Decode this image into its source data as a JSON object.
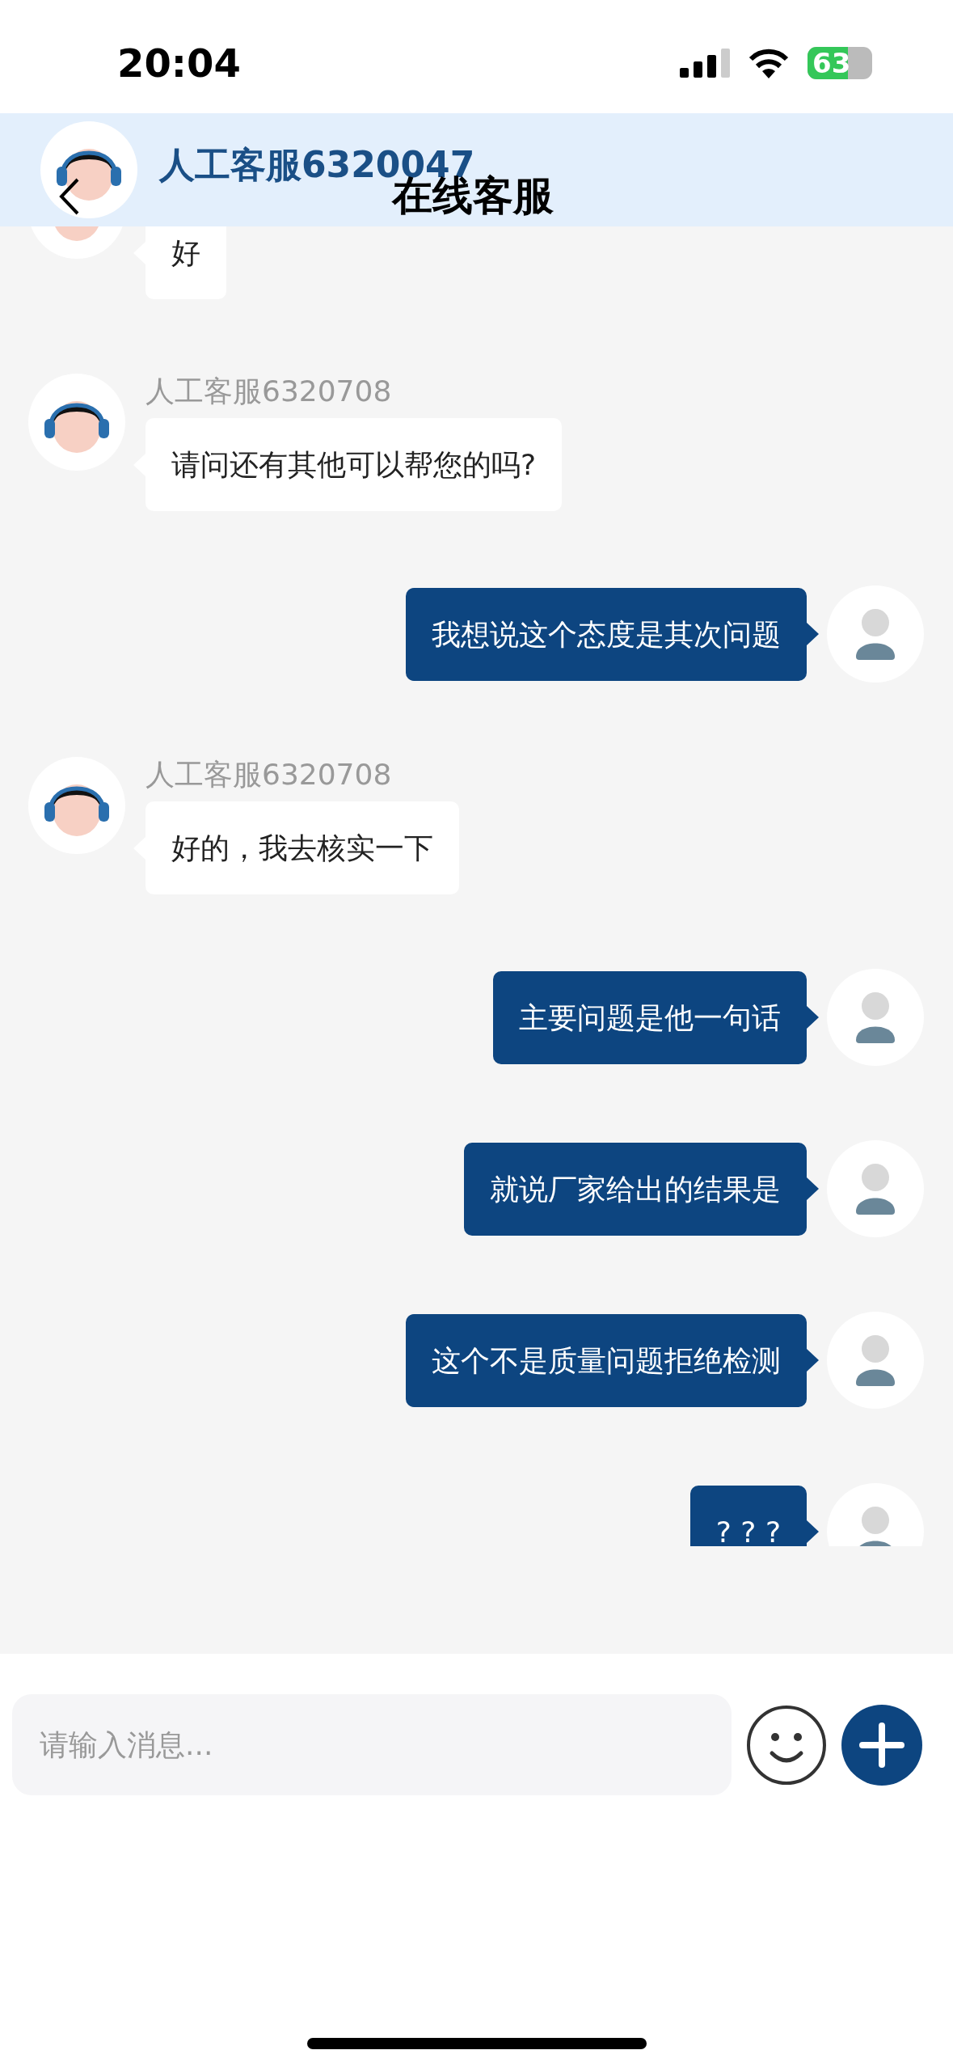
{
  "status_bar": {
    "time": "20:04",
    "battery": "63"
  },
  "header": {
    "agent_name": "人工客服6320047",
    "title": "在线客服"
  },
  "messages": [
    {
      "kind": "agent",
      "text": "好"
    },
    {
      "kind": "agent",
      "name": "人工客服6320708",
      "text": "请问还有其他可以帮您的吗?"
    },
    {
      "kind": "user",
      "text": "我想说这个态度是其次问题"
    },
    {
      "kind": "agent",
      "name": "人工客服6320708",
      "text": "好的，我去核实一下"
    },
    {
      "kind": "user",
      "text": "主要问题是他一句话"
    },
    {
      "kind": "user",
      "text": "就说厂家给出的结果是"
    },
    {
      "kind": "user",
      "text": "这个不是质量问题拒绝检测"
    },
    {
      "kind": "user",
      "text": "? ? ?"
    }
  ],
  "composer": {
    "placeholder": "请输入消息..."
  }
}
